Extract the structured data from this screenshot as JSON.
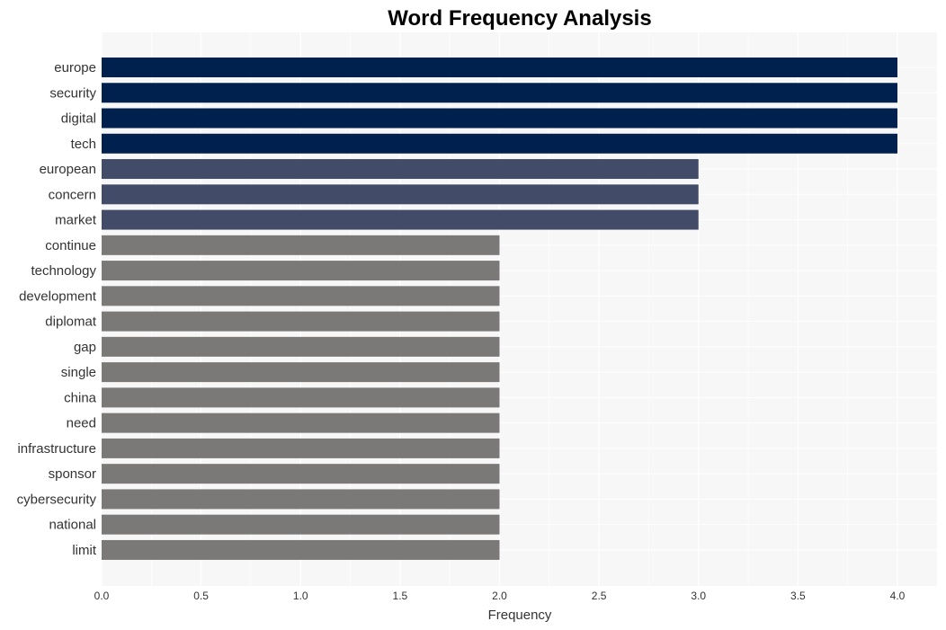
{
  "chart_data": {
    "type": "bar",
    "orientation": "horizontal",
    "title": "Word Frequency Analysis",
    "xlabel": "Frequency",
    "ylabel": "",
    "xlim": [
      0,
      4.2
    ],
    "xticks": [
      0.0,
      0.5,
      1.0,
      1.5,
      2.0,
      2.5,
      3.0,
      3.5,
      4.0
    ],
    "xtick_labels": [
      "0.0",
      "0.5",
      "1.0",
      "1.5",
      "2.0",
      "2.5",
      "3.0",
      "3.5",
      "4.0"
    ],
    "grid": true,
    "legend": "none",
    "categories": [
      "europe",
      "security",
      "digital",
      "tech",
      "european",
      "concern",
      "market",
      "continue",
      "technology",
      "development",
      "diplomat",
      "gap",
      "single",
      "china",
      "need",
      "infrastructure",
      "sponsor",
      "cybersecurity",
      "national",
      "limit"
    ],
    "values": [
      4,
      4,
      4,
      4,
      3,
      3,
      3,
      2,
      2,
      2,
      2,
      2,
      2,
      2,
      2,
      2,
      2,
      2,
      2,
      2
    ],
    "colors_by_value": {
      "4": "#00204e",
      "3": "#424c69",
      "2": "#7a7978"
    },
    "background": "#f7f7f7",
    "gridline_color": "#ffffff"
  }
}
